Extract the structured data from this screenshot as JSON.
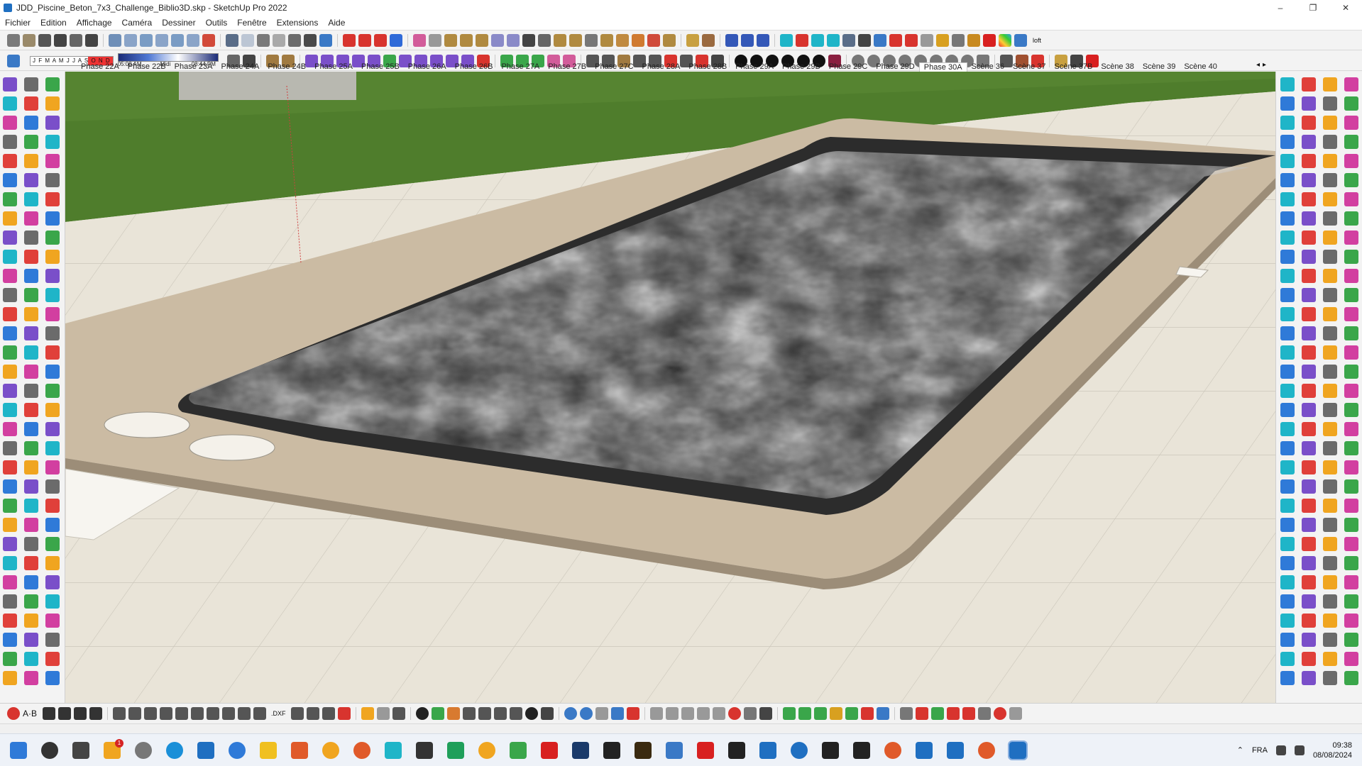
{
  "window": {
    "title": "JDD_Piscine_Beton_7x3_Challenge_Biblio3D.skp - SketchUp Pro 2022",
    "controls": [
      "–",
      "❐",
      "✕"
    ]
  },
  "menu": {
    "items": [
      "Fichier",
      "Edition",
      "Affichage",
      "Caméra",
      "Dessiner",
      "Outils",
      "Fenêtre",
      "Extensions",
      "Aide"
    ]
  },
  "shadows": {
    "months": "J F M A M J J A S O N D",
    "sunrise": "05:08 AM",
    "noon": "Midi",
    "sunset": "08:44 PM"
  },
  "scenes": {
    "tabs": [
      "Phase 22A",
      "Phase 22B",
      "Phase 23A",
      "Phase 24A",
      "Phase 24B",
      "Phase 25A",
      "Phase 25B",
      "Phase 26A",
      "Phase 26B",
      "Phase 27A",
      "Phase 27B",
      "Phase 27C",
      "Phase 28A",
      "Phase 28B",
      "Phase 29A",
      "Phase 29B",
      "Phase 29C",
      "Phase 29D",
      "Phase 30A",
      "Scène 36",
      "Scène 37",
      "Scène 37B",
      "Scène 38",
      "Scène 39",
      "Scène 40"
    ],
    "active": "Phase 30A",
    "nav_prev": "◂",
    "nav_next": "▸"
  },
  "bottom_toolbar": {
    "ab_label": "A·B",
    "dxf_label": ".DXF"
  },
  "toolbar_right": {
    "loft_label": "loft"
  },
  "taskbar": {
    "language": "FRA",
    "time": "09:38",
    "date": "08/08/2024",
    "badge_count": "1"
  },
  "icons": {
    "accent_colors": [
      "#e0403a",
      "#2f7ad8",
      "#3aa64a",
      "#f0a520",
      "#7a4fc9",
      "#1fb5c8",
      "#d23fa0",
      "#6b6b6b"
    ]
  }
}
